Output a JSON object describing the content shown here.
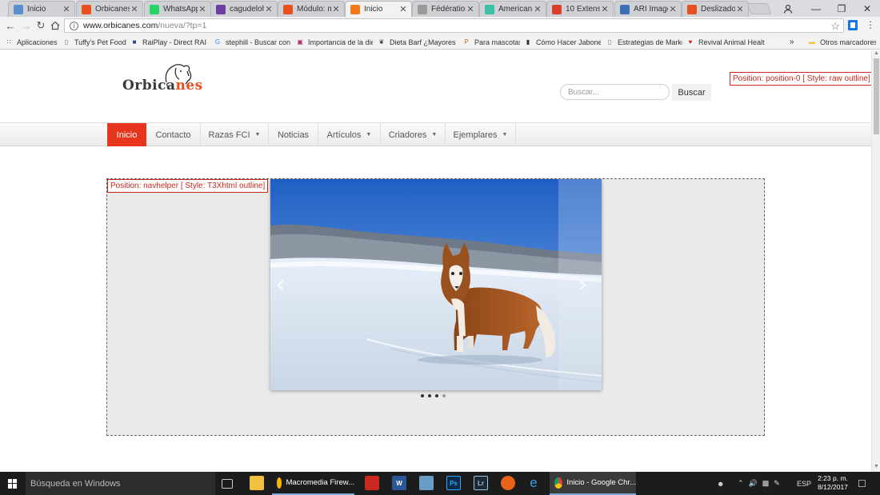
{
  "browser": {
    "tabs": [
      {
        "label": "Inicio",
        "icon": "dog-favicon-icon",
        "color": "#5a8fd0"
      },
      {
        "label": "Orbicanes |",
        "icon": "orbicanes-favicon-icon",
        "color": "#e8501f"
      },
      {
        "label": "WhatsApp",
        "icon": "whatsapp-icon",
        "color": "#25d366"
      },
      {
        "label": "cagudelohi",
        "icon": "mail-icon",
        "color": "#6a3fa0"
      },
      {
        "label": "Módulo: m",
        "icon": "orbicanes-favicon-icon",
        "color": "#e8501f"
      },
      {
        "label": "Inicio",
        "icon": "joomla-icon",
        "color": "#f07a1a"
      },
      {
        "label": "Fédération",
        "icon": "page-icon",
        "color": "#9a9a9a"
      },
      {
        "label": "American",
        "icon": "ms-icon",
        "color": "#3dbfa8"
      },
      {
        "label": "10 Extensio",
        "icon": "m-icon",
        "color": "#d9412b"
      },
      {
        "label": "ARI Image",
        "icon": "ari-icon",
        "color": "#3d6fb4"
      },
      {
        "label": "Deslizador",
        "icon": "orbicanes-favicon-icon",
        "color": "#e8501f"
      }
    ],
    "active_tab_index": 5,
    "url_host": "www.orbicanes.com",
    "url_path": "/nueva/?tp=1",
    "bookmarks": [
      {
        "label": "Aplicaciones",
        "icon": "apps-grid-icon"
      },
      {
        "label": "Tuffy's Pet Foods",
        "icon": "page-icon"
      },
      {
        "label": "RaiPlay - Direct RAI",
        "icon": "rai-icon"
      },
      {
        "label": "stephill - Buscar con",
        "icon": "google-icon"
      },
      {
        "label": "Importancia de la die",
        "icon": "ig-icon"
      },
      {
        "label": "Dieta Barf ¿Mayores",
        "icon": "dog-icon"
      },
      {
        "label": "Para mascotas",
        "icon": "pin-icon"
      },
      {
        "label": "Cómo Hacer Jabones",
        "icon": "bottle-icon"
      },
      {
        "label": "Estrategias de Marke",
        "icon": "page-icon"
      },
      {
        "label": "Revival Animal Healt",
        "icon": "heart-icon"
      },
      {
        "label": "Otros marcadores",
        "icon": "folder-icon"
      }
    ],
    "bookmarks_overflow": "»"
  },
  "site": {
    "logo_text_dark": "Orbica",
    "logo_text_orange": "nes",
    "search_placeholder": "Buscar...",
    "search_button": "Buscar",
    "position0_label": "Position: position-0 [ Style: raw outline]",
    "navhelper_label": "Position: navhelper [ Style: T3Xhtml outline]",
    "nav": [
      {
        "label": "Inicio",
        "dropdown": false,
        "active": true
      },
      {
        "label": "Contacto",
        "dropdown": false,
        "active": false
      },
      {
        "label": "Razas FCI",
        "dropdown": true,
        "active": false
      },
      {
        "label": "Noticias",
        "dropdown": false,
        "active": false
      },
      {
        "label": "Artículos",
        "dropdown": true,
        "active": false
      },
      {
        "label": "Criadores",
        "dropdown": true,
        "active": false
      },
      {
        "label": "Ejemplares",
        "dropdown": true,
        "active": false
      }
    ],
    "slider": {
      "image": "siberian-husky-in-snow",
      "prev_arrow": "‹",
      "next_arrow": "›",
      "slide_count": 4,
      "current_slide": 4
    },
    "accent_color": "#e8361e"
  },
  "taskbar": {
    "search_placeholder": "Búsqueda en Windows",
    "apps": [
      {
        "label": "Macromedia Firew...",
        "icon": "fireworks-icon"
      },
      {
        "label": "Inicio - Google Chr...",
        "icon": "chrome-icon"
      }
    ],
    "language": "ESP",
    "time": "2:23 p. m.",
    "date": "8/12/2017"
  }
}
